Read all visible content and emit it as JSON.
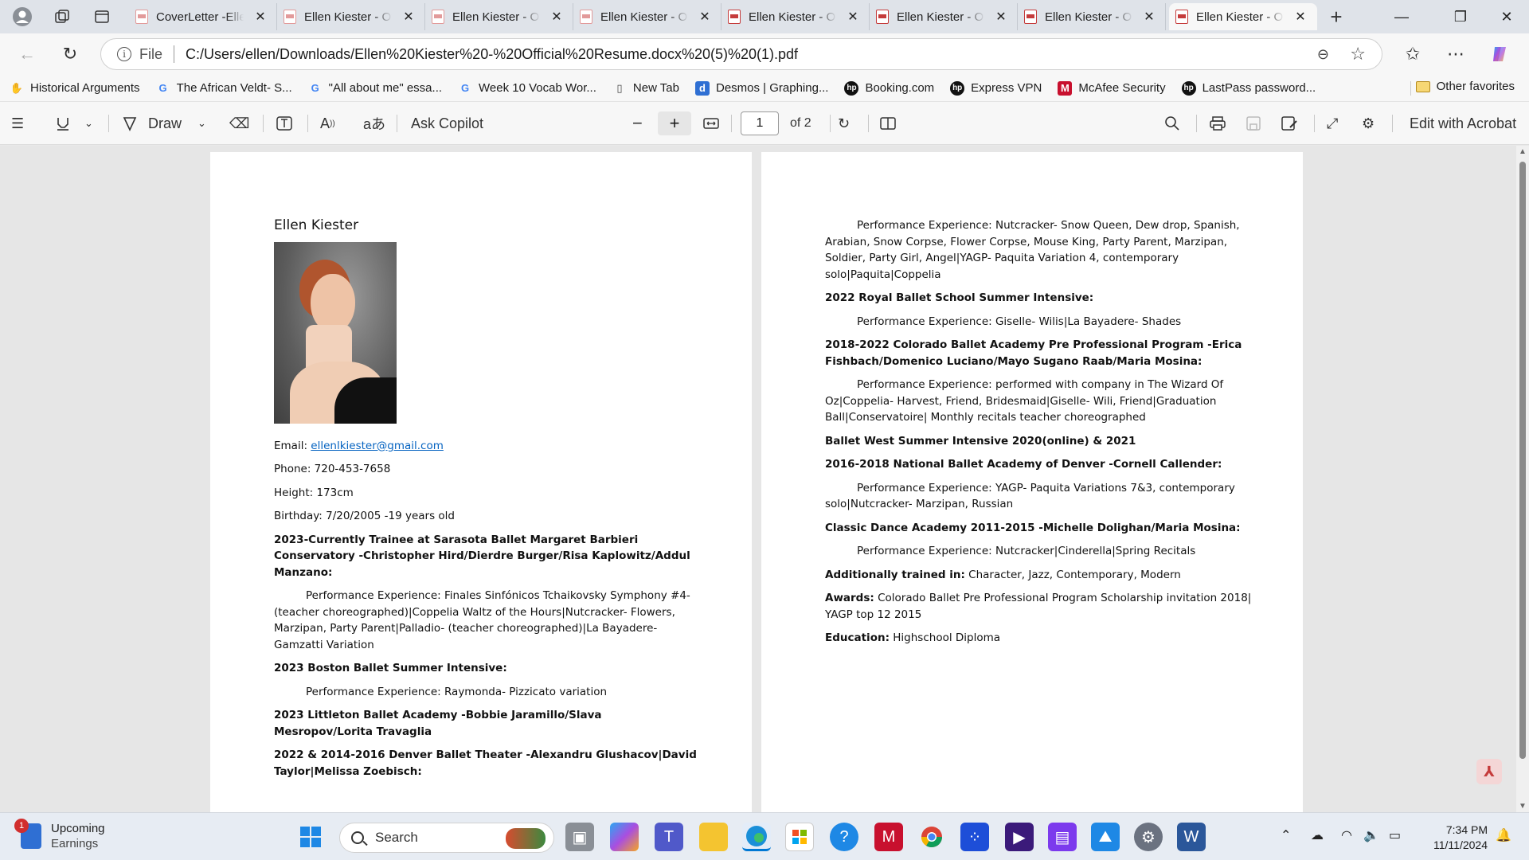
{
  "browser": {
    "tabs": [
      {
        "title": "CoverLetter -Elle",
        "active": false
      },
      {
        "title": "Ellen Kiester - Of",
        "active": false
      },
      {
        "title": "Ellen Kiester - Of",
        "active": false
      },
      {
        "title": "Ellen Kiester - Of",
        "active": false
      },
      {
        "title": "Ellen Kiester - Of",
        "active": false
      },
      {
        "title": "Ellen Kiester - Of",
        "active": false
      },
      {
        "title": "Ellen Kiester - Of",
        "active": false
      },
      {
        "title": "Ellen Kiester - Of",
        "active": true
      }
    ],
    "address": {
      "scheme_label": "File",
      "url": "C:/Users/ellen/Downloads/Ellen%20Kiester%20-%20Official%20Resume.docx%20(5)%20(1).pdf"
    },
    "bookmarks": [
      {
        "label": "Historical Arguments",
        "icon": "hand-icon",
        "color": "#c0392b"
      },
      {
        "label": "The African Veldt- S...",
        "icon": "google-icon",
        "color": "#4285f4"
      },
      {
        "label": "\"All about me\" essa...",
        "icon": "google-icon",
        "color": "#4285f4"
      },
      {
        "label": "Week 10 Vocab Wor...",
        "icon": "google-icon",
        "color": "#4285f4"
      },
      {
        "label": "New Tab",
        "icon": "page-icon",
        "color": "#444444"
      },
      {
        "label": "Desmos | Graphing...",
        "icon": "desmos-icon",
        "color": "#2f6fd3"
      },
      {
        "label": "Booking.com",
        "icon": "hp-icon",
        "color": "#111111"
      },
      {
        "label": "Express VPN",
        "icon": "hp-icon",
        "color": "#111111"
      },
      {
        "label": "McAfee Security",
        "icon": "mcafee-icon",
        "color": "#c8102e"
      },
      {
        "label": "LastPass password...",
        "icon": "hp-icon",
        "color": "#111111"
      }
    ],
    "other_favorites": "Other favorites"
  },
  "pdf_toolbar": {
    "draw_label": "Draw",
    "copilot_label": "Ask Copilot",
    "page_current": "1",
    "page_total": "of 2",
    "edit_label": "Edit with Acrobat"
  },
  "resume": {
    "name": "Ellen Kiester",
    "email_label": "Email: ",
    "email": "ellenlkiester@gmail.com",
    "phone": "Phone: 720-453-7658",
    "height": "Height: 173cm",
    "birthday": "Birthday: 7/20/2005 -19 years old",
    "page1_sections": [
      {
        "heading": "2023-Currently Trainee at Sarasota Ballet Margaret Barbieri Conservatory -Christopher Hird/Dierdre Burger/Risa Kaplowitz/Addul Manzano:",
        "detail": "Performance Experience: Finales Sinfónicos Tchaikovsky Symphony #4- (teacher choreographed)|Coppelia Waltz of the Hours|Nutcracker- Flowers, Marzipan, Party Parent|Palladio- (teacher choreographed)|La Bayadere- Gamzatti Variation"
      },
      {
        "heading": "2023 Boston Ballet Summer Intensive:",
        "detail": "Performance Experience: Raymonda- Pizzicato variation"
      },
      {
        "heading": "2023 Littleton Ballet Academy -Bobbie Jaramillo/Slava Mesropov/Lorita Travaglia",
        "detail": ""
      },
      {
        "heading": "2022 & 2014-2016 Denver Ballet Theater -Alexandru Glushacov|David Taylor|Melissa Zoebisch:",
        "detail": ""
      }
    ],
    "page2_lead": "Performance Experience: Nutcracker- Snow Queen, Dew drop, Spanish, Arabian, Snow Corpse, Flower Corpse, Mouse King, Party Parent, Marzipan, Soldier, Party Girl, Angel|YAGP- Paquita Variation 4, contemporary solo|Paquita|Coppelia",
    "page2_sections": [
      {
        "heading": "2022 Royal Ballet School Summer Intensive:",
        "detail": "Performance Experience: Giselle- Wilis|La Bayadere- Shades"
      },
      {
        "heading": "2018-2022 Colorado Ballet Academy Pre Professional Program -Erica Fishbach/Domenico Luciano/Mayo Sugano Raab/Maria Mosina:",
        "detail": "Performance Experience: performed with company in The Wizard Of Oz|Coppelia- Harvest, Friend, Bridesmaid|Giselle- Wili, Friend|Graduation Ball|Conservatoire| Monthly recitals teacher choreographed"
      },
      {
        "heading": "Ballet West Summer Intensive 2020(online) & 2021",
        "detail": ""
      },
      {
        "heading": "2016-2018 National Ballet Academy of Denver -Cornell Callender:",
        "detail": " Performance Experience: YAGP- Paquita Variations 7&3, contemporary solo|Nutcracker- Marzipan, Russian"
      },
      {
        "heading": "Classic Dance Academy 2011-2015 -Michelle Dolighan/Maria Mosina:",
        "detail": "Performance Experience: Nutcracker|Cinderella|Spring Recitals"
      }
    ],
    "additional_label": "Additionally trained in:",
    "additional_value": " Character, Jazz, Contemporary, Modern",
    "awards_label": "Awards:",
    "awards_value": " Colorado Ballet Pre Professional Program Scholarship invitation 2018| YAGP top 12 2015",
    "education_label": "Education:",
    "education_value": " Highschool Diploma"
  },
  "taskbar": {
    "weather_title": "Upcoming",
    "weather_sub": "Earnings",
    "weather_badge": "1",
    "search_placeholder": "Search",
    "time": "7:34 PM",
    "date": "11/11/2024"
  }
}
